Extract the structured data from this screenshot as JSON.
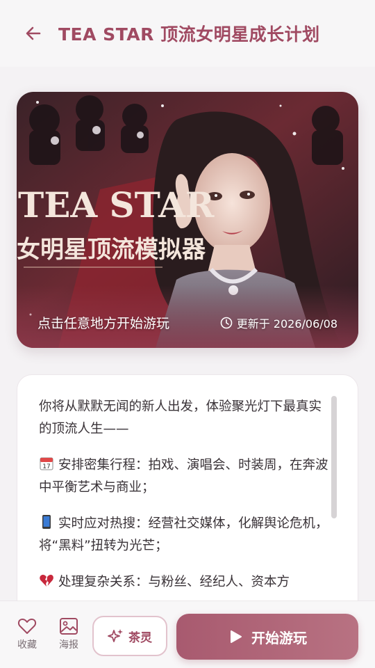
{
  "header": {
    "title": "TEA STAR 顶流女明星成长计划",
    "back_icon": "arrow-left-icon"
  },
  "banner": {
    "cta": "点击任意地方开始游玩",
    "updated": "更新于 2026/06/08",
    "poster_title_line1": "TEA STAR",
    "poster_title_line2": "女明星顶流模拟器",
    "clock_icon": "clock-icon"
  },
  "description": {
    "intro": "你将从默默无闻的新人出发，体验聚光灯下最真实的顶流人生——",
    "items": [
      {
        "icon": "calendar-icon",
        "text": "安排密集行程：拍戏、演唱会、时装周，在奔波中平衡艺术与商业；"
      },
      {
        "icon": "mobile-phone-icon",
        "text": "实时应对热搜：经营社交媒体，化解舆论危机，将“黑料”扭转为光芒；"
      },
      {
        "icon": "broken-heart-icon",
        "text": "处理复杂关系：与粉丝、经纪人、资本方"
      }
    ]
  },
  "bottom_bar": {
    "favorite_label": "收藏",
    "poster_label": "海报",
    "spirit_label": "茶灵",
    "play_label": "开始游玩"
  },
  "colors": {
    "accent": "#a04a62",
    "play_button": "#b06679",
    "background": "#f4f2f4"
  }
}
